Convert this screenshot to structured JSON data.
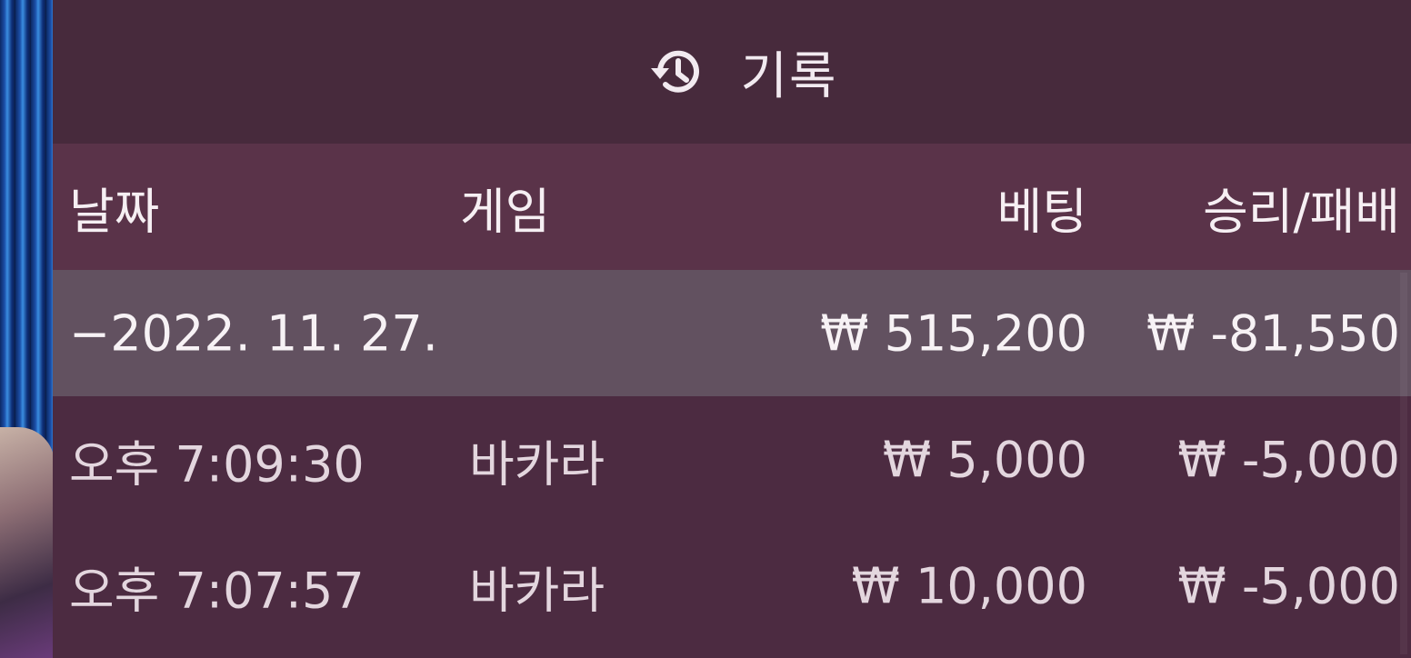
{
  "panel": {
    "title": "기록",
    "icon": "history-icon"
  },
  "columns": {
    "date": "날짜",
    "game": "게임",
    "bet": "베팅",
    "win_loss": "승리/패배"
  },
  "summary": {
    "date": "−2022. 11. 27.",
    "bet": "₩ 515,200",
    "win_loss": "₩ -81,550"
  },
  "entries": [
    {
      "time": "오후 7:09:30",
      "game": "바카라",
      "bet": "₩ 5,000",
      "win_loss": "₩ -5,000"
    },
    {
      "time": "오후 7:07:57",
      "game": "바카라",
      "bet": "₩ 10,000",
      "win_loss": "₩ -5,000"
    }
  ],
  "colors": {
    "panel_bg": "#4c2b41",
    "header_bg": "#472a3c",
    "column_header_bg": "#5a3349",
    "summary_row_bg": "#625160",
    "text": "#efe6ec"
  }
}
